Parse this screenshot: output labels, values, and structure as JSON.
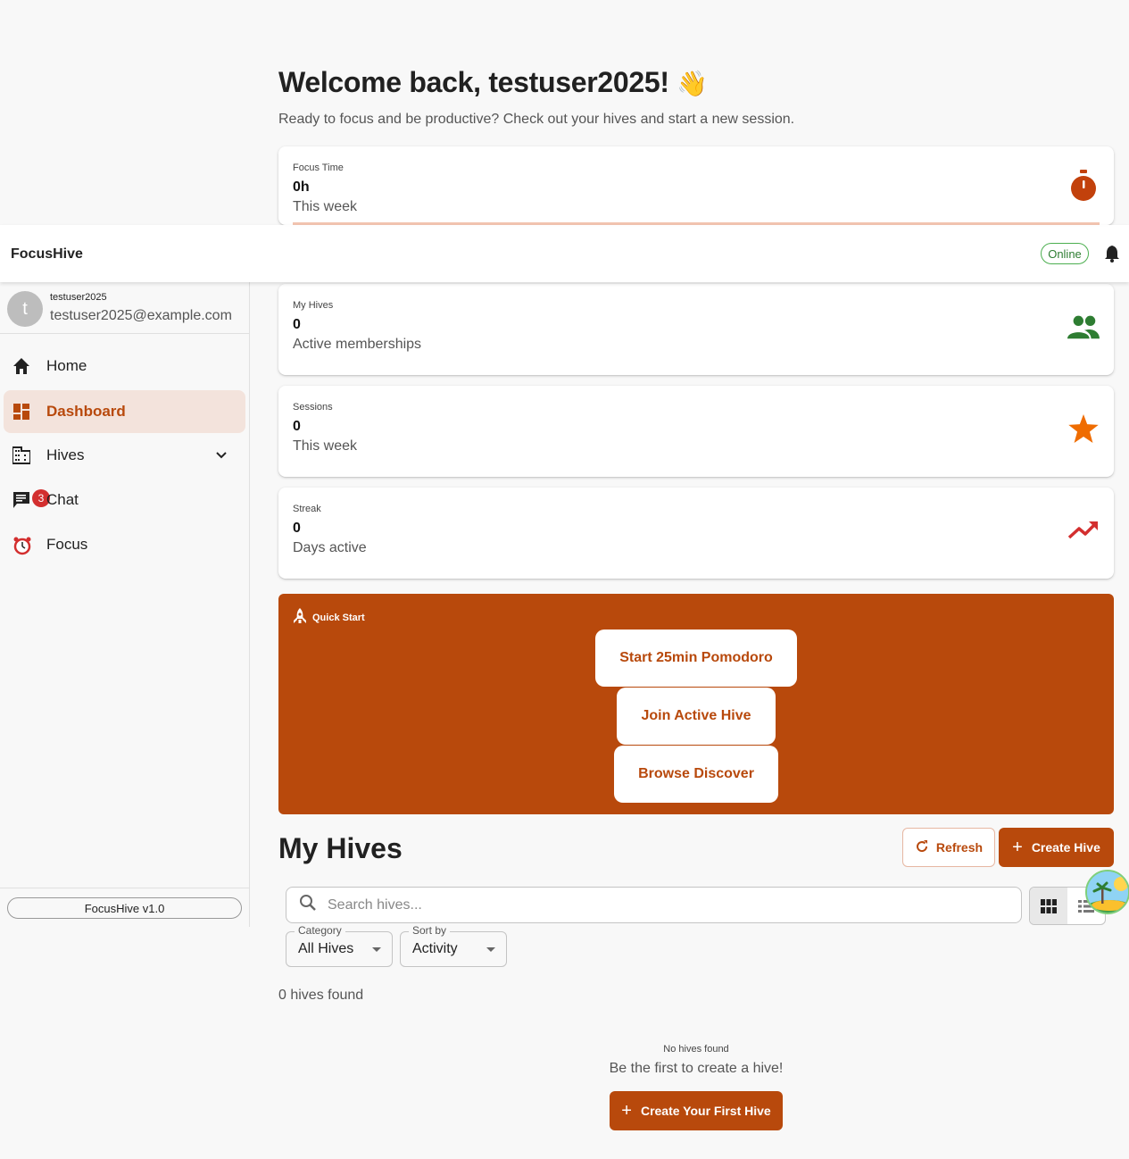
{
  "header": {
    "welcome": "Welcome back, testuser2025!",
    "wave_emoji": "👋",
    "subtitle": "Ready to focus and be productive? Check out your hives and start a new session."
  },
  "stats": [
    {
      "label": "Focus Time",
      "value": "0h",
      "sub": "This week",
      "icon": "timer-icon",
      "color": "#c2410c"
    },
    {
      "label": "My Hives",
      "value": "0",
      "sub": "Active memberships",
      "icon": "group-icon",
      "color": "#2e7d32"
    },
    {
      "label": "Sessions",
      "value": "0",
      "sub": "This week",
      "icon": "star-icon",
      "color": "#ef6c00"
    },
    {
      "label": "Streak",
      "value": "0",
      "sub": "Days active",
      "icon": "trending-up-icon",
      "color": "#d32f2f"
    }
  ],
  "quick_start": {
    "title": "Quick Start",
    "buttons": [
      "Start 25min Pomodoro",
      "Join Active Hive",
      "Browse Discover"
    ]
  },
  "hives": {
    "title": "My Hives",
    "refresh_label": "Refresh",
    "create_label": "Create Hive",
    "search_placeholder": "Search hives...",
    "category_label": "Category",
    "category_value": "All Hives",
    "sort_label": "Sort by",
    "sort_value": "Activity",
    "count_text": "0 hives found",
    "empty_title": "No hives found",
    "empty_sub": "Be the first to create a hive!",
    "first_button": "Create Your First Hive"
  },
  "appbar": {
    "brand": "FocusHive",
    "status": "Online",
    "status_color": "#4caf50"
  },
  "sidebar": {
    "avatar_letter": "t",
    "username": "testuser2025",
    "email": "testuser2025@example.com",
    "items": [
      {
        "label": "Home",
        "icon": "home-icon"
      },
      {
        "label": "Dashboard",
        "icon": "dashboard-icon",
        "active": true
      },
      {
        "label": "Hives",
        "icon": "building-icon"
      },
      {
        "label": "Chat",
        "icon": "chat-icon",
        "badge": "3"
      },
      {
        "label": "Focus",
        "icon": "alarm-clock-icon"
      }
    ],
    "version": "FocusHive v1.0"
  },
  "colors": {
    "accent": "#b8490c",
    "accent_light": "#f3e3dc"
  }
}
